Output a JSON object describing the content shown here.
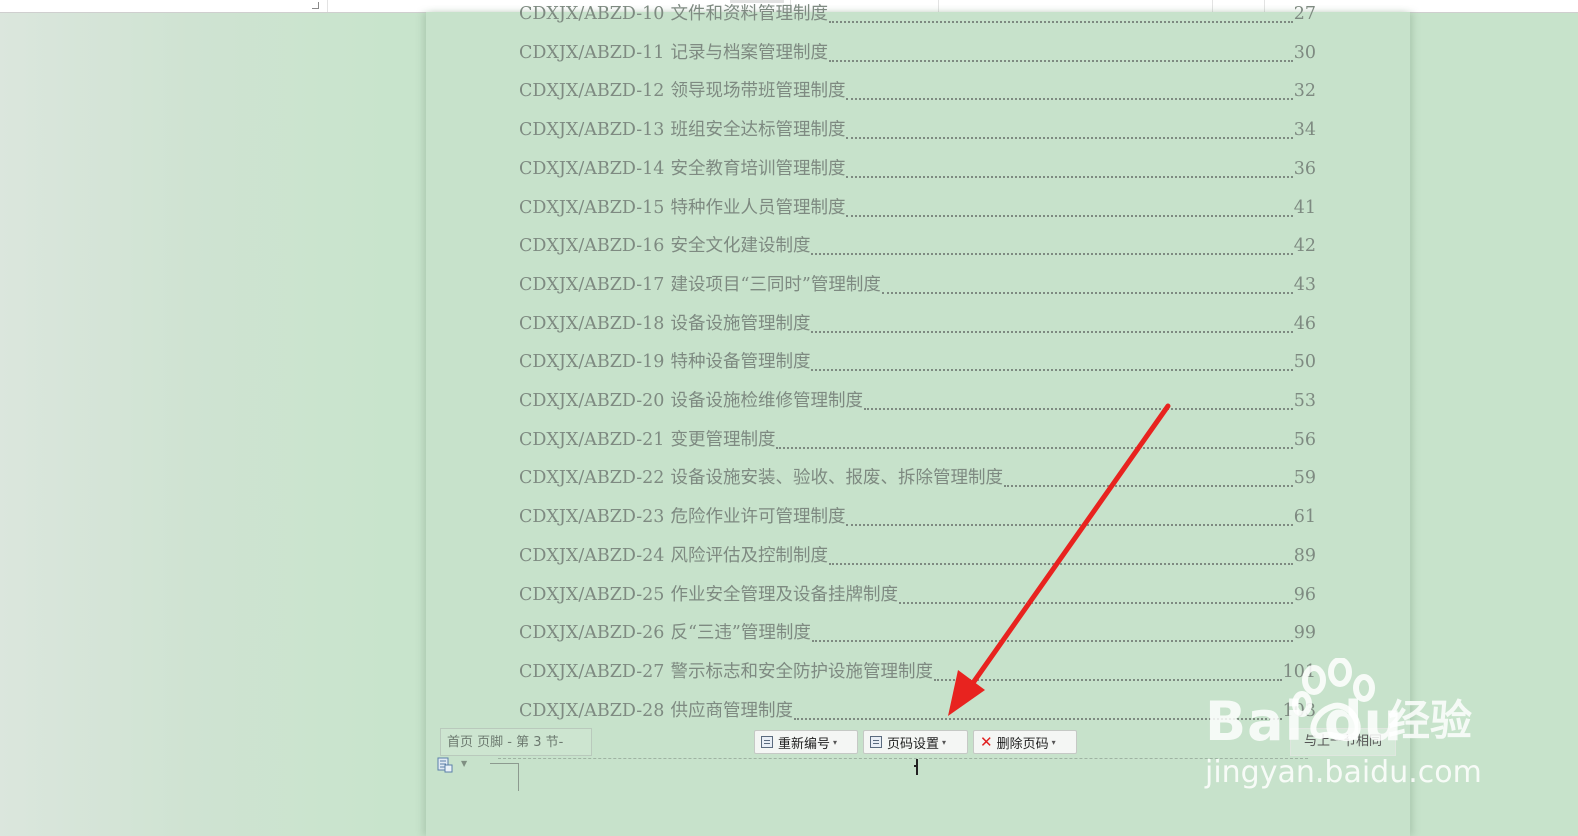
{
  "toc": {
    "entries": [
      {
        "code": "CDXJX/ABZD-10",
        "title": "文件和资料管理制度",
        "page": "27"
      },
      {
        "code": "CDXJX/ABZD-11",
        "title": "记录与档案管理制度",
        "page": "30"
      },
      {
        "code": "CDXJX/ABZD-12",
        "title": "领导现场带班管理制度",
        "page": "32"
      },
      {
        "code": "CDXJX/ABZD-13",
        "title": "班组安全达标管理制度",
        "page": "34"
      },
      {
        "code": "CDXJX/ABZD-14",
        "title": "安全教育培训管理制度",
        "page": "36"
      },
      {
        "code": "CDXJX/ABZD-15",
        "title": "特种作业人员管理制度",
        "page": "41"
      },
      {
        "code": "CDXJX/ABZD-16",
        "title": "安全文化建设制度",
        "page": "42"
      },
      {
        "code": "CDXJX/ABZD-17",
        "title": "建设项目“三同时”管理制度",
        "page": "43"
      },
      {
        "code": "CDXJX/ABZD-18",
        "title": "设备设施管理制度",
        "page": "46"
      },
      {
        "code": "CDXJX/ABZD-19",
        "title": "特种设备管理制度",
        "page": "50"
      },
      {
        "code": "CDXJX/ABZD-20",
        "title": "设备设施检维修管理制度",
        "page": "53"
      },
      {
        "code": "CDXJX/ABZD-21",
        "title": "变更管理制度",
        "page": "56"
      },
      {
        "code": "CDXJX/ABZD-22",
        "title": "设备设施安装、验收、报废、拆除管理制度",
        "page": "59"
      },
      {
        "code": "CDXJX/ABZD-23",
        "title": "危险作业许可管理制度",
        "page": "61"
      },
      {
        "code": "CDXJX/ABZD-24",
        "title": "风险评估及控制制度",
        "page": "89"
      },
      {
        "code": "CDXJX/ABZD-25",
        "title": "作业安全管理及设备挂牌制度",
        "page": "96"
      },
      {
        "code": "CDXJX/ABZD-26",
        "title": "反“三违”管理制度",
        "page": "99"
      },
      {
        "code": "CDXJX/ABZD-27",
        "title": "警示标志和安全防护设施管理制度",
        "page": "101"
      },
      {
        "code": "CDXJX/ABZD-28",
        "title": "供应商管理制度",
        "page": "103"
      }
    ]
  },
  "footer": {
    "section_label": "首页 页脚  - 第 3 节-",
    "renumber_label": "重新编号",
    "page_setup_label": "页码设置",
    "delete_label": "删除页码",
    "right_button_label": "与上一节相同",
    "cursor_char": "1"
  },
  "watermark": {
    "logo_text": "Bai  du",
    "jingyan": "经验",
    "url": "jingyan.baidu.com"
  },
  "colors": {
    "page_background": "#c7e2cb",
    "text": "#7e8a81",
    "arrow": "#e8231f"
  }
}
